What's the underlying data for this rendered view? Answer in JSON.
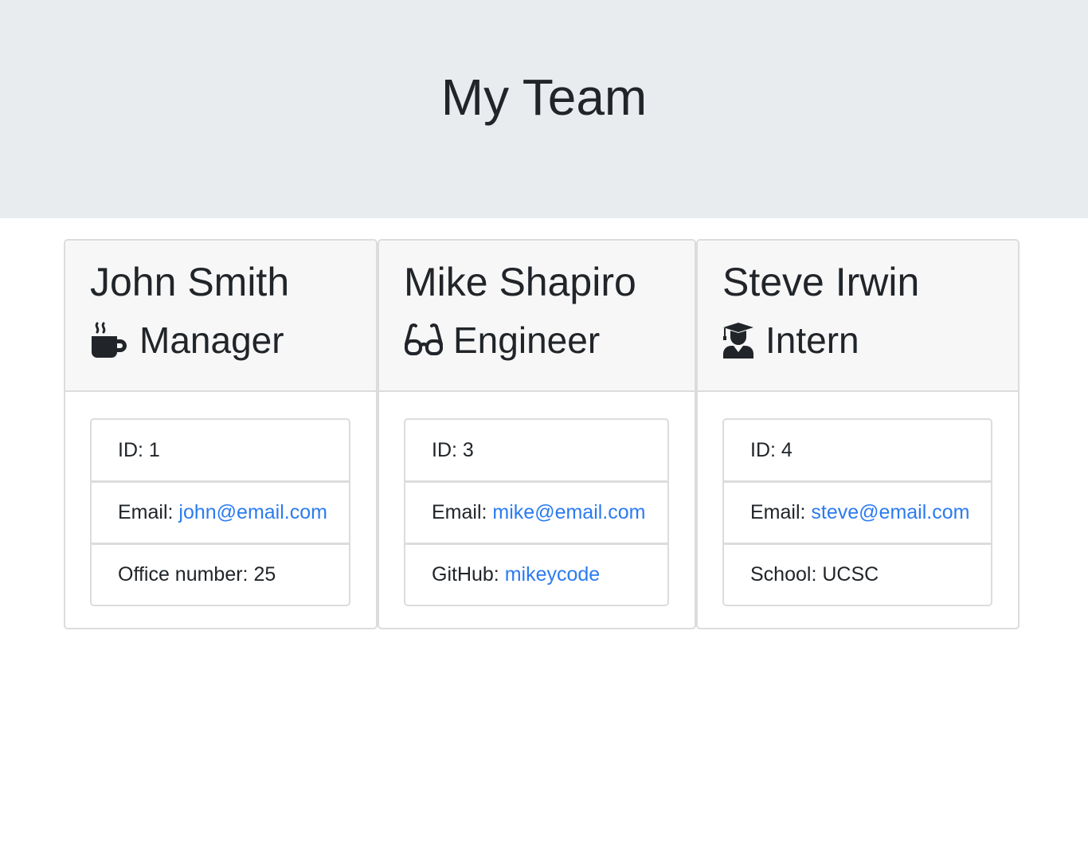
{
  "header": {
    "title": "My Team"
  },
  "colors": {
    "header_bg": "#e9ecef",
    "card_header_bg": "#f7f7f7",
    "link": "#2b7bf0",
    "text": "#212529"
  },
  "employees": [
    {
      "name": "John Smith",
      "role": "Manager",
      "icon": "mug-hot-icon",
      "id_text": "ID: 1",
      "email_label": "Email: ",
      "email": "john@email.com",
      "extra_label": "Office number: 25",
      "extra_link": ""
    },
    {
      "name": "Mike Shapiro",
      "role": "Engineer",
      "icon": "glasses-icon",
      "id_text": "ID: 3",
      "email_label": "Email: ",
      "email": "mike@email.com",
      "extra_label": "GitHub: ",
      "extra_link": "mikeycode"
    },
    {
      "name": "Steve Irwin",
      "role": "Intern",
      "icon": "user-graduate-icon",
      "id_text": "ID: 4",
      "email_label": "Email: ",
      "email": "steve@email.com",
      "extra_label": "School: UCSC",
      "extra_link": ""
    }
  ]
}
